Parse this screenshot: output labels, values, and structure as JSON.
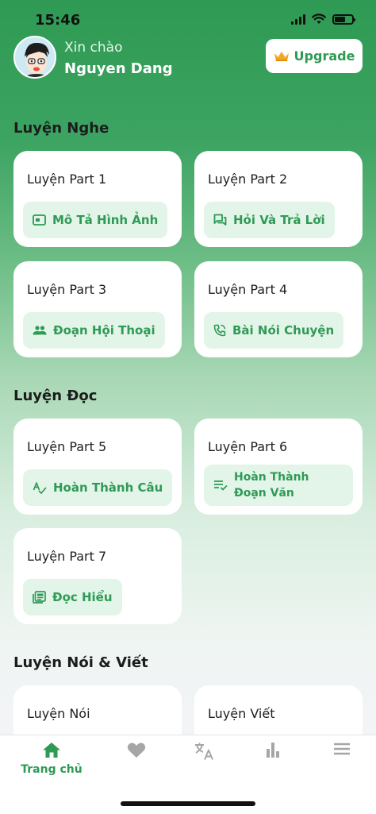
{
  "status": {
    "time": "15:46"
  },
  "header": {
    "greeting": "Xin chào",
    "username": "Nguyen Dang",
    "upgrade_label": "Upgrade"
  },
  "sections": {
    "listening": {
      "title": "Luyện Nghe",
      "cards": [
        {
          "title": "Luyện Part 1",
          "action": "Mô Tả Hình Ảnh",
          "icon": "image-icon"
        },
        {
          "title": "Luyện Part 2",
          "action": "Hỏi Và Trả Lời",
          "icon": "chat-icon"
        },
        {
          "title": "Luyện Part 3",
          "action": "Đoạn Hội Thoại",
          "icon": "group-icon"
        },
        {
          "title": "Luyện Part 4",
          "action": "Bài Nói Chuyện",
          "icon": "phone-icon"
        }
      ]
    },
    "reading": {
      "title": "Luyện Đọc",
      "cards": [
        {
          "title": "Luyện Part 5",
          "action": "Hoàn Thành Câu",
          "icon": "spellcheck-icon"
        },
        {
          "title": "Luyện Part 6",
          "action": "Hoàn Thành Đoạn Văn",
          "icon": "list-check-icon"
        },
        {
          "title": "Luyện Part 7",
          "action": "Đọc Hiểu",
          "icon": "newspaper-icon"
        }
      ]
    },
    "speaking_writing": {
      "title": "Luyện Nói & Viết",
      "cards": [
        {
          "title": "Luyện Nói"
        },
        {
          "title": "Luyện Viết"
        }
      ]
    }
  },
  "nav": {
    "active": "home",
    "items": [
      {
        "id": "home",
        "label": "Trang chủ",
        "icon": "home-icon"
      },
      {
        "id": "favorites",
        "label": "",
        "icon": "heart-icon"
      },
      {
        "id": "translate",
        "label": "",
        "icon": "translate-icon"
      },
      {
        "id": "stats",
        "label": "",
        "icon": "bar-chart-icon"
      },
      {
        "id": "menu",
        "label": "",
        "icon": "menu-icon"
      }
    ]
  },
  "colors": {
    "brand": "#2e9a53",
    "pill_bg": "#e2f5e8",
    "inactive_icon": "#a6a6a6"
  }
}
